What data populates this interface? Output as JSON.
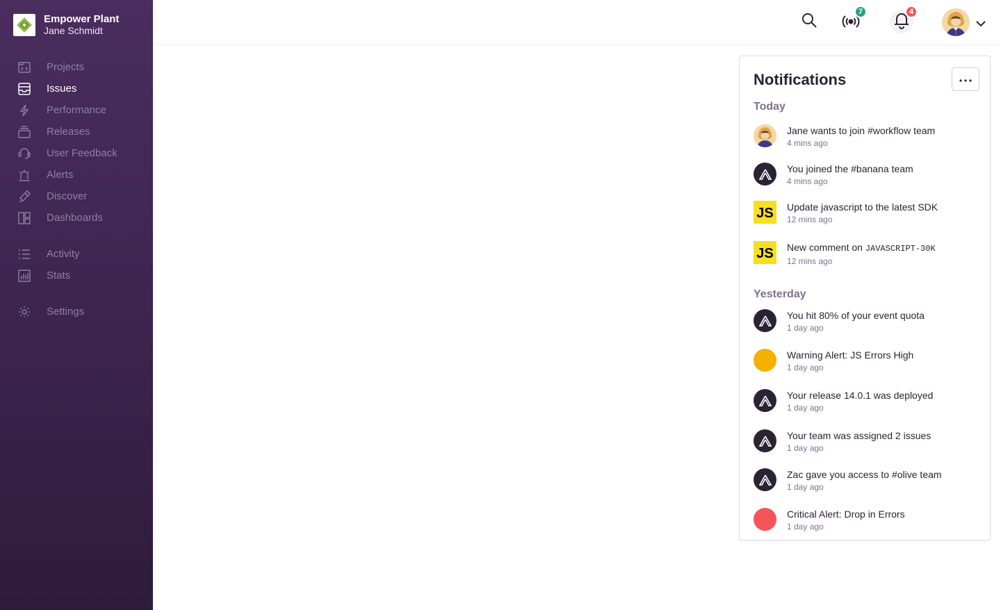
{
  "org": {
    "name": "Empower Plant",
    "user": "Jane Schmidt"
  },
  "nav": {
    "primary": [
      {
        "label": "Projects",
        "icon": "projects-icon"
      },
      {
        "label": "Issues",
        "icon": "issues-icon",
        "active": true
      },
      {
        "label": "Performance",
        "icon": "performance-icon"
      },
      {
        "label": "Releases",
        "icon": "releases-icon"
      },
      {
        "label": "User Feedback",
        "icon": "user-feedback-icon"
      },
      {
        "label": "Alerts",
        "icon": "alerts-icon"
      },
      {
        "label": "Discover",
        "icon": "discover-icon"
      },
      {
        "label": "Dashboards",
        "icon": "dashboards-icon"
      }
    ],
    "secondary": [
      {
        "label": "Activity",
        "icon": "activity-icon"
      },
      {
        "label": "Stats",
        "icon": "stats-icon"
      }
    ],
    "settings": {
      "label": "Settings",
      "icon": "settings-icon"
    }
  },
  "topbar": {
    "broadcast_badge": "7",
    "notifications_badge": "4",
    "colors": {
      "broadcast_badge": "#2ba185",
      "notifications_badge": "#f55459"
    }
  },
  "notifications": {
    "title": "Notifications",
    "today_label": "Today",
    "yesterday_label": "Yesterday",
    "today": [
      {
        "text": "Jane wants to join #workflow team",
        "time": "4 mins ago",
        "icon": "user-avatar"
      },
      {
        "text": "You joined the #banana team",
        "time": "4 mins ago",
        "icon": "sentry-icon"
      },
      {
        "text": "Update javascript to the latest SDK",
        "time": "12 mins ago",
        "icon": "javascript-icon"
      },
      {
        "text": "New comment on ",
        "code": "JAVASCRIPT-30K",
        "time": "12 mins ago",
        "icon": "javascript-icon"
      }
    ],
    "yesterday": [
      {
        "text": "You hit 80% of your event quota",
        "time": "1 day ago",
        "icon": "sentry-icon"
      },
      {
        "text": "Warning Alert: JS Errors High",
        "time": "1 day ago",
        "icon": "warning-dot",
        "color": "#f5b000"
      },
      {
        "text": "Your release 14.0.1 was deployed",
        "time": "1 day ago",
        "icon": "sentry-icon"
      },
      {
        "text": "Your team was assigned 2 issues",
        "time": "1 day ago",
        "icon": "sentry-icon"
      },
      {
        "text": "Zac gave you access to #olive team",
        "time": "1 day ago",
        "icon": "sentry-icon"
      },
      {
        "text": "Critical Alert: Drop in Errors",
        "time": "1 day ago",
        "icon": "critical-dot",
        "color": "#f55459"
      }
    ]
  }
}
